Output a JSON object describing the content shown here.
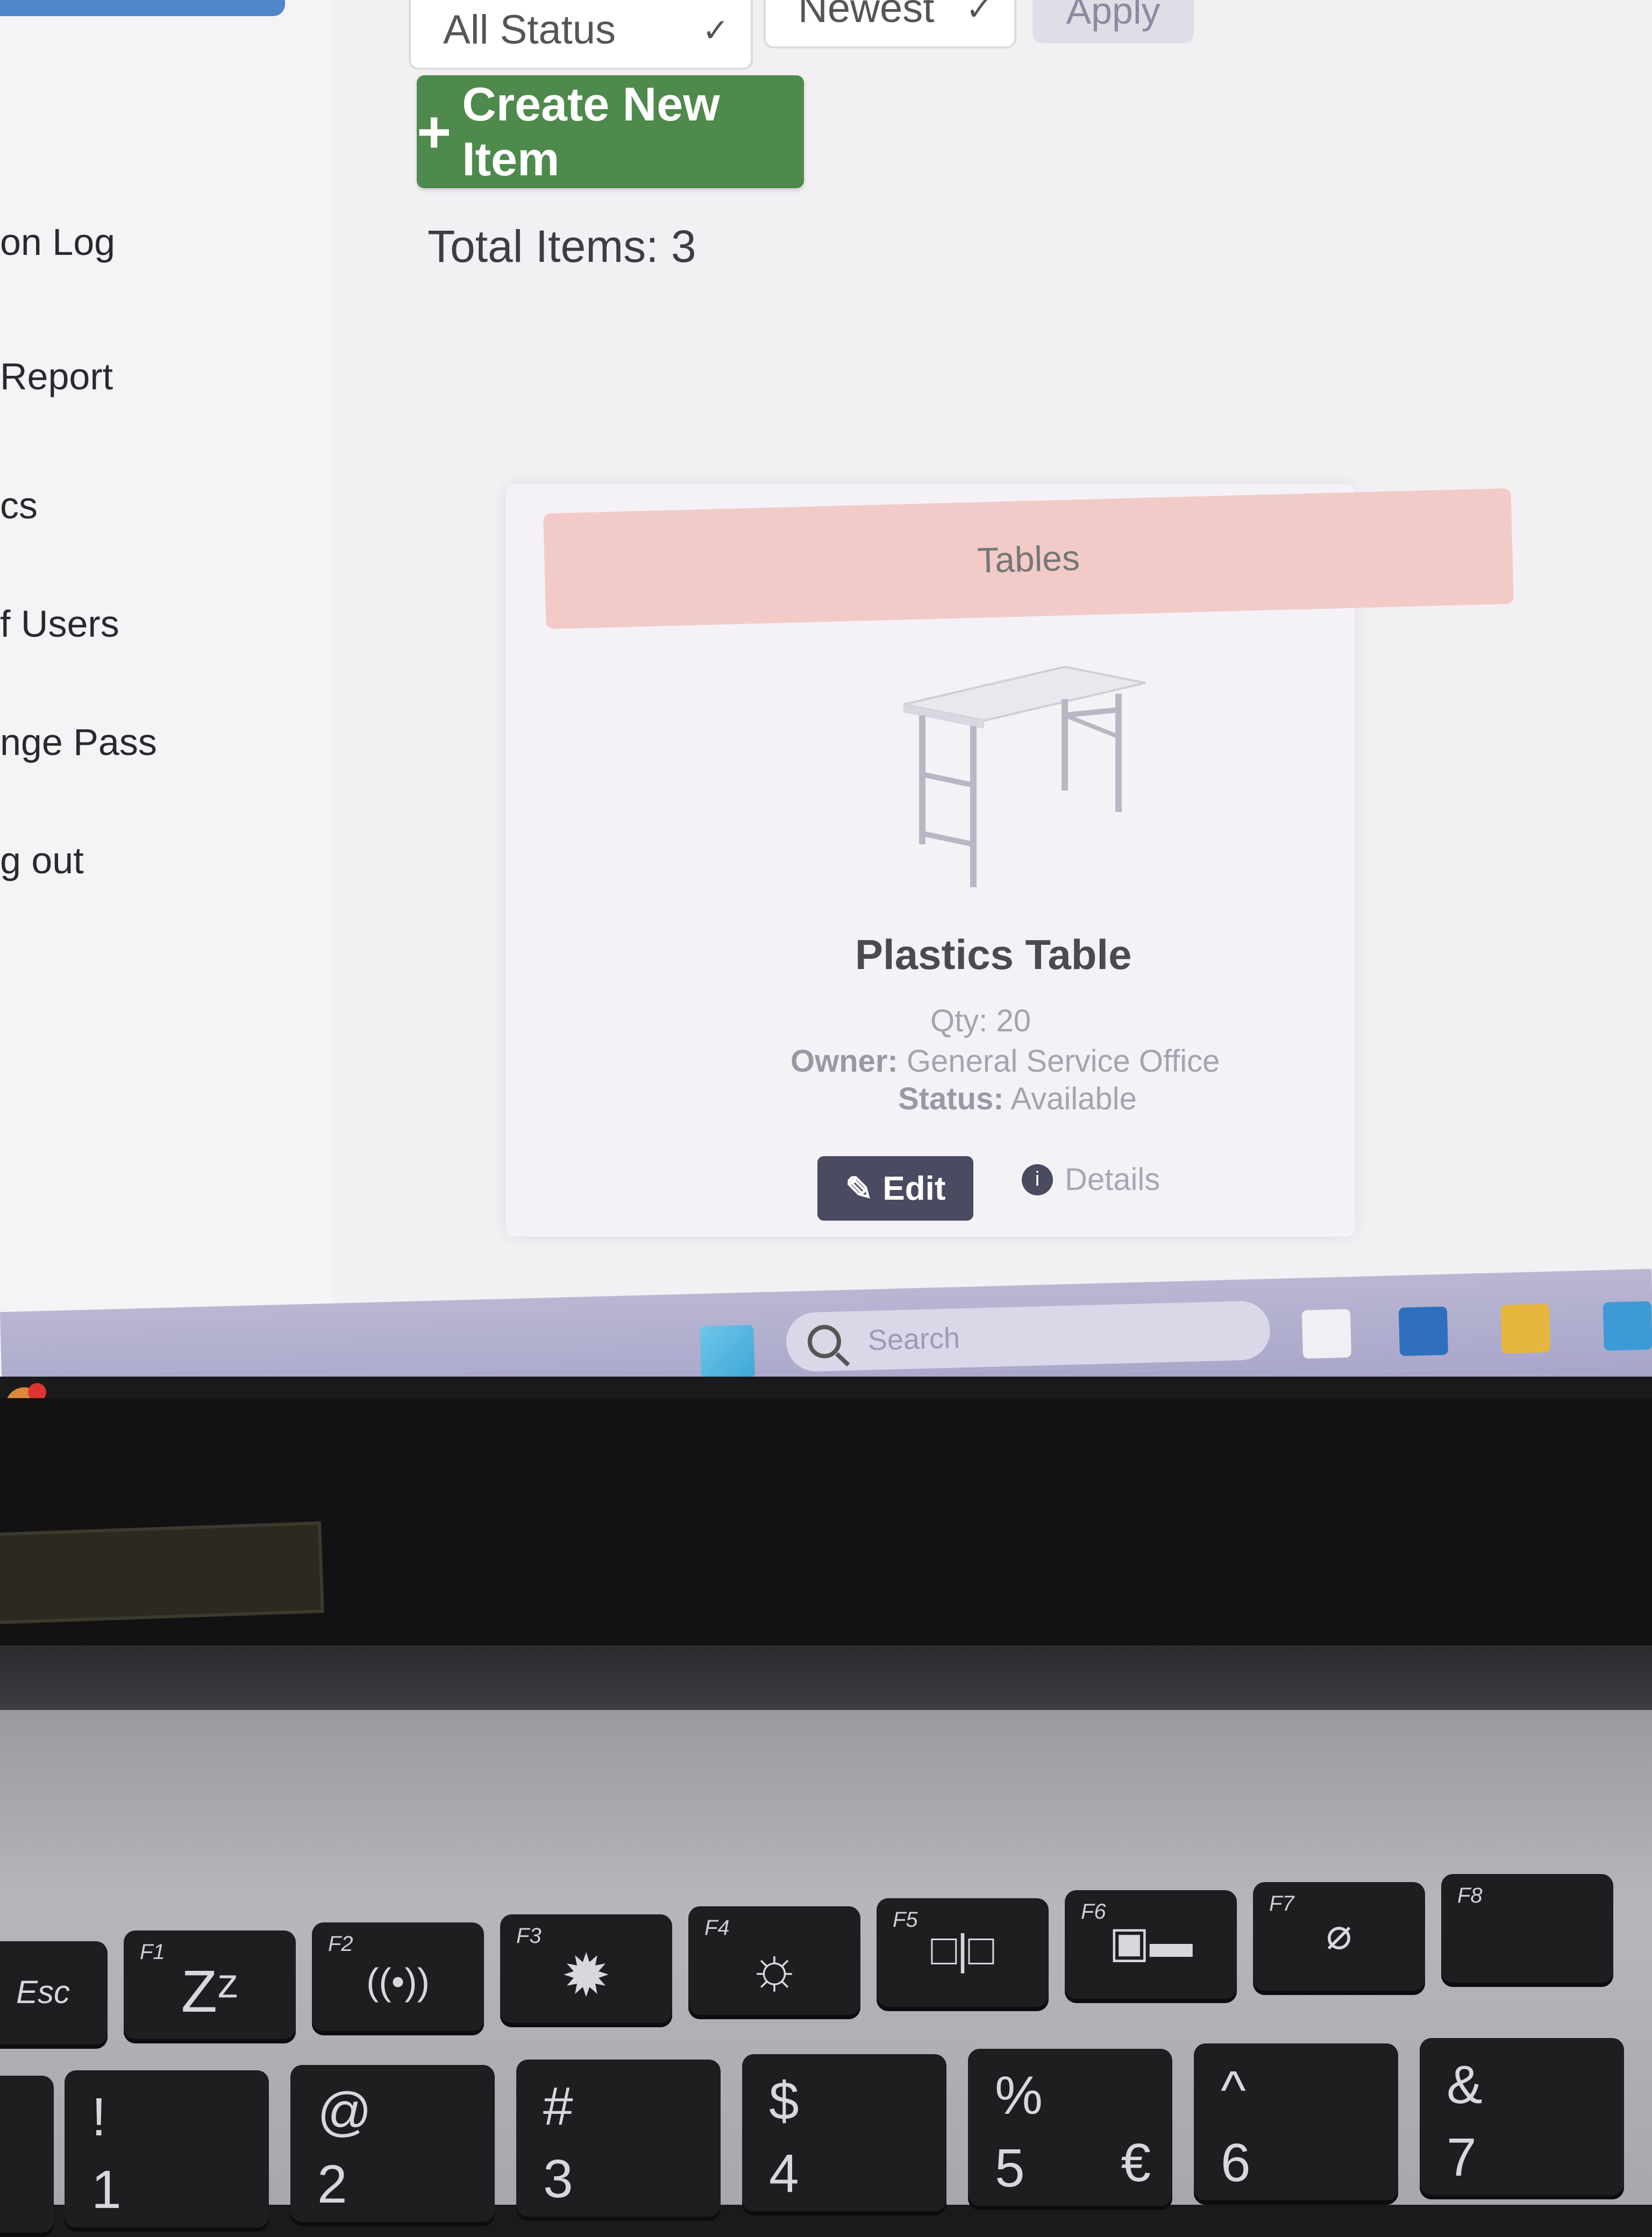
{
  "sidebar": {
    "items": [
      {
        "label": "on Log"
      },
      {
        "label": "Report"
      },
      {
        "label": "cs"
      },
      {
        "label": "f Users"
      },
      {
        "label": "nge Pass"
      },
      {
        "label": "g out"
      }
    ]
  },
  "filters": {
    "status_value": "All Status",
    "sort_value": "Newest",
    "apply_label": "Apply"
  },
  "toolbar": {
    "create_label": "Create New Item"
  },
  "summary": {
    "total_label": "Total Items: 3"
  },
  "card": {
    "category": "Tables",
    "name": "Plastics Table",
    "qty": "Qty: 20",
    "owner_label": "Owner:",
    "owner_value": "General Service Office",
    "status_label": "Status:",
    "status_value": "Available",
    "edit_label": "Edit",
    "details_label": "Details",
    "details_dot": "i"
  },
  "taskbar": {
    "search_placeholder": "Search"
  },
  "keyboard": {
    "function_row": [
      {
        "fn": "",
        "glyph": "Esc"
      },
      {
        "fn": "F1",
        "glyph": "Zᶻ"
      },
      {
        "fn": "F2",
        "glyph": "((•))"
      },
      {
        "fn": "F3",
        "glyph": "✹"
      },
      {
        "fn": "F4",
        "glyph": "☼"
      },
      {
        "fn": "F5",
        "glyph": "□|□"
      },
      {
        "fn": "F6",
        "glyph": "▣▬"
      },
      {
        "fn": "F7",
        "glyph": "⌀"
      },
      {
        "fn": "F8",
        "glyph": ""
      }
    ],
    "number_row": [
      {
        "top": "!",
        "bottom": "1",
        "extra": ""
      },
      {
        "top": "@",
        "bottom": "2",
        "extra": ""
      },
      {
        "top": "#",
        "bottom": "3",
        "extra": ""
      },
      {
        "top": "$",
        "bottom": "4",
        "extra": ""
      },
      {
        "top": "%",
        "bottom": "5",
        "extra": "€"
      },
      {
        "top": "^",
        "bottom": "6",
        "extra": ""
      },
      {
        "top": "&",
        "bottom": "7",
        "extra": ""
      }
    ]
  }
}
